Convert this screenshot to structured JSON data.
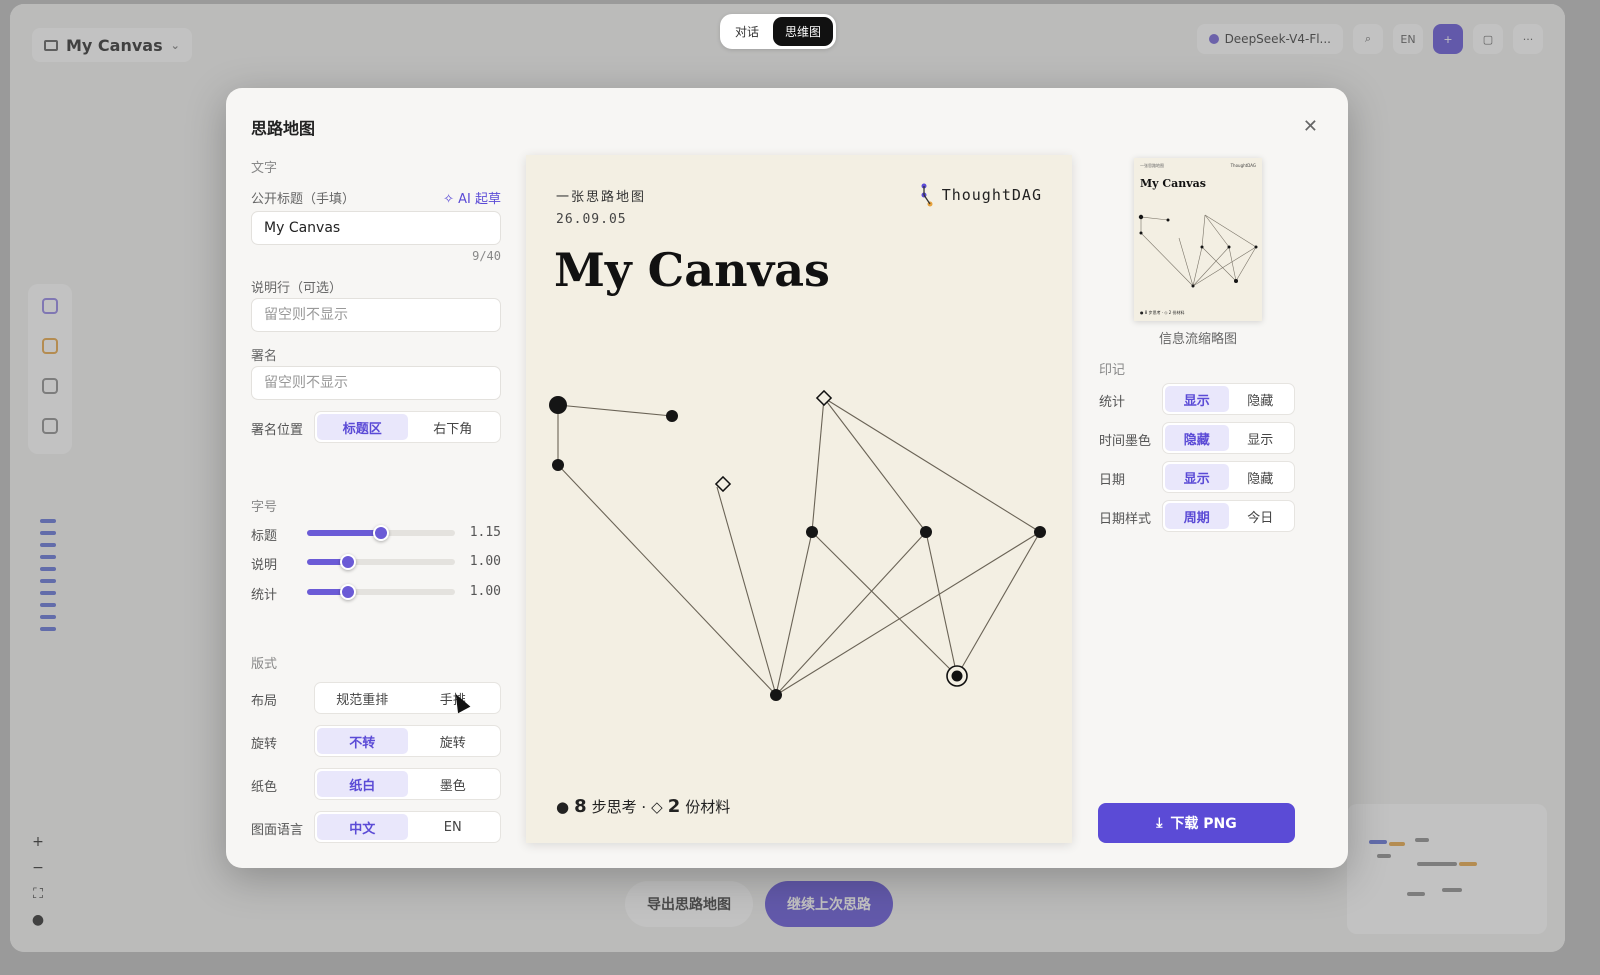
{
  "app": {
    "title": "My Canvas",
    "modes": [
      "对话",
      "思维图"
    ],
    "active_mode": "思维图",
    "model": "DeepSeek-V4-Fl...",
    "lang_button": "EN",
    "bottom_buttons": [
      "导出思路地图",
      "继续上次思路"
    ]
  },
  "modal": {
    "title": "思路地图",
    "text_section": "文字",
    "public_title_label": "公开标题（手填）",
    "ai_draft": "AI 起草",
    "public_title_value": "My Canvas",
    "public_title_counter": "9/40",
    "caption_label": "说明行（可选）",
    "caption_placeholder": "留空则不显示",
    "signature_label": "署名",
    "signature_placeholder": "留空则不显示",
    "signature_pos_label": "署名位置",
    "signature_pos_options": [
      "标题区",
      "右下角"
    ],
    "signature_pos_selected": "标题区",
    "font_section": "字号",
    "sliders": [
      {
        "label": "标题",
        "value": "1.15",
        "fraction": 0.5
      },
      {
        "label": "说明",
        "value": "1.00",
        "fraction": 0.28
      },
      {
        "label": "统计",
        "value": "1.00",
        "fraction": 0.28
      }
    ],
    "layout_section": "版式",
    "layout_rows": [
      {
        "label": "布局",
        "options": [
          "规范重排",
          "手排"
        ],
        "selected": -1
      },
      {
        "label": "旋转",
        "options": [
          "不转",
          "旋转"
        ],
        "selected": 0
      },
      {
        "label": "纸色",
        "options": [
          "纸白",
          "墨色"
        ],
        "selected": 0
      },
      {
        "label": "图面语言",
        "options": [
          "中文",
          "EN"
        ],
        "selected": 0
      }
    ],
    "poster": {
      "subtitle": "一张思路地图",
      "date": "26.09.05",
      "brand": "ThoughtDAG",
      "title": "My Canvas",
      "steps_count": "8",
      "steps_label": "步思考 ·",
      "materials_count": "2",
      "materials_label": "份材料"
    },
    "thumbnail_caption": "信息流缩略图",
    "stamp_section": "印记",
    "stamp_rows": [
      {
        "label": "统计",
        "options": [
          "显示",
          "隐藏"
        ],
        "selected": 0
      },
      {
        "label": "时间墨色",
        "options": [
          "隐藏",
          "显示"
        ],
        "selected": 0
      },
      {
        "label": "日期",
        "options": [
          "显示",
          "隐藏"
        ],
        "selected": 0
      },
      {
        "label": "日期样式",
        "options": [
          "周期",
          "今日"
        ],
        "selected": 0
      }
    ],
    "download_button": "下载 PNG"
  },
  "colors": {
    "accent": "#5b4bd6",
    "paper": "#f3efe3",
    "ink": "#111111"
  }
}
